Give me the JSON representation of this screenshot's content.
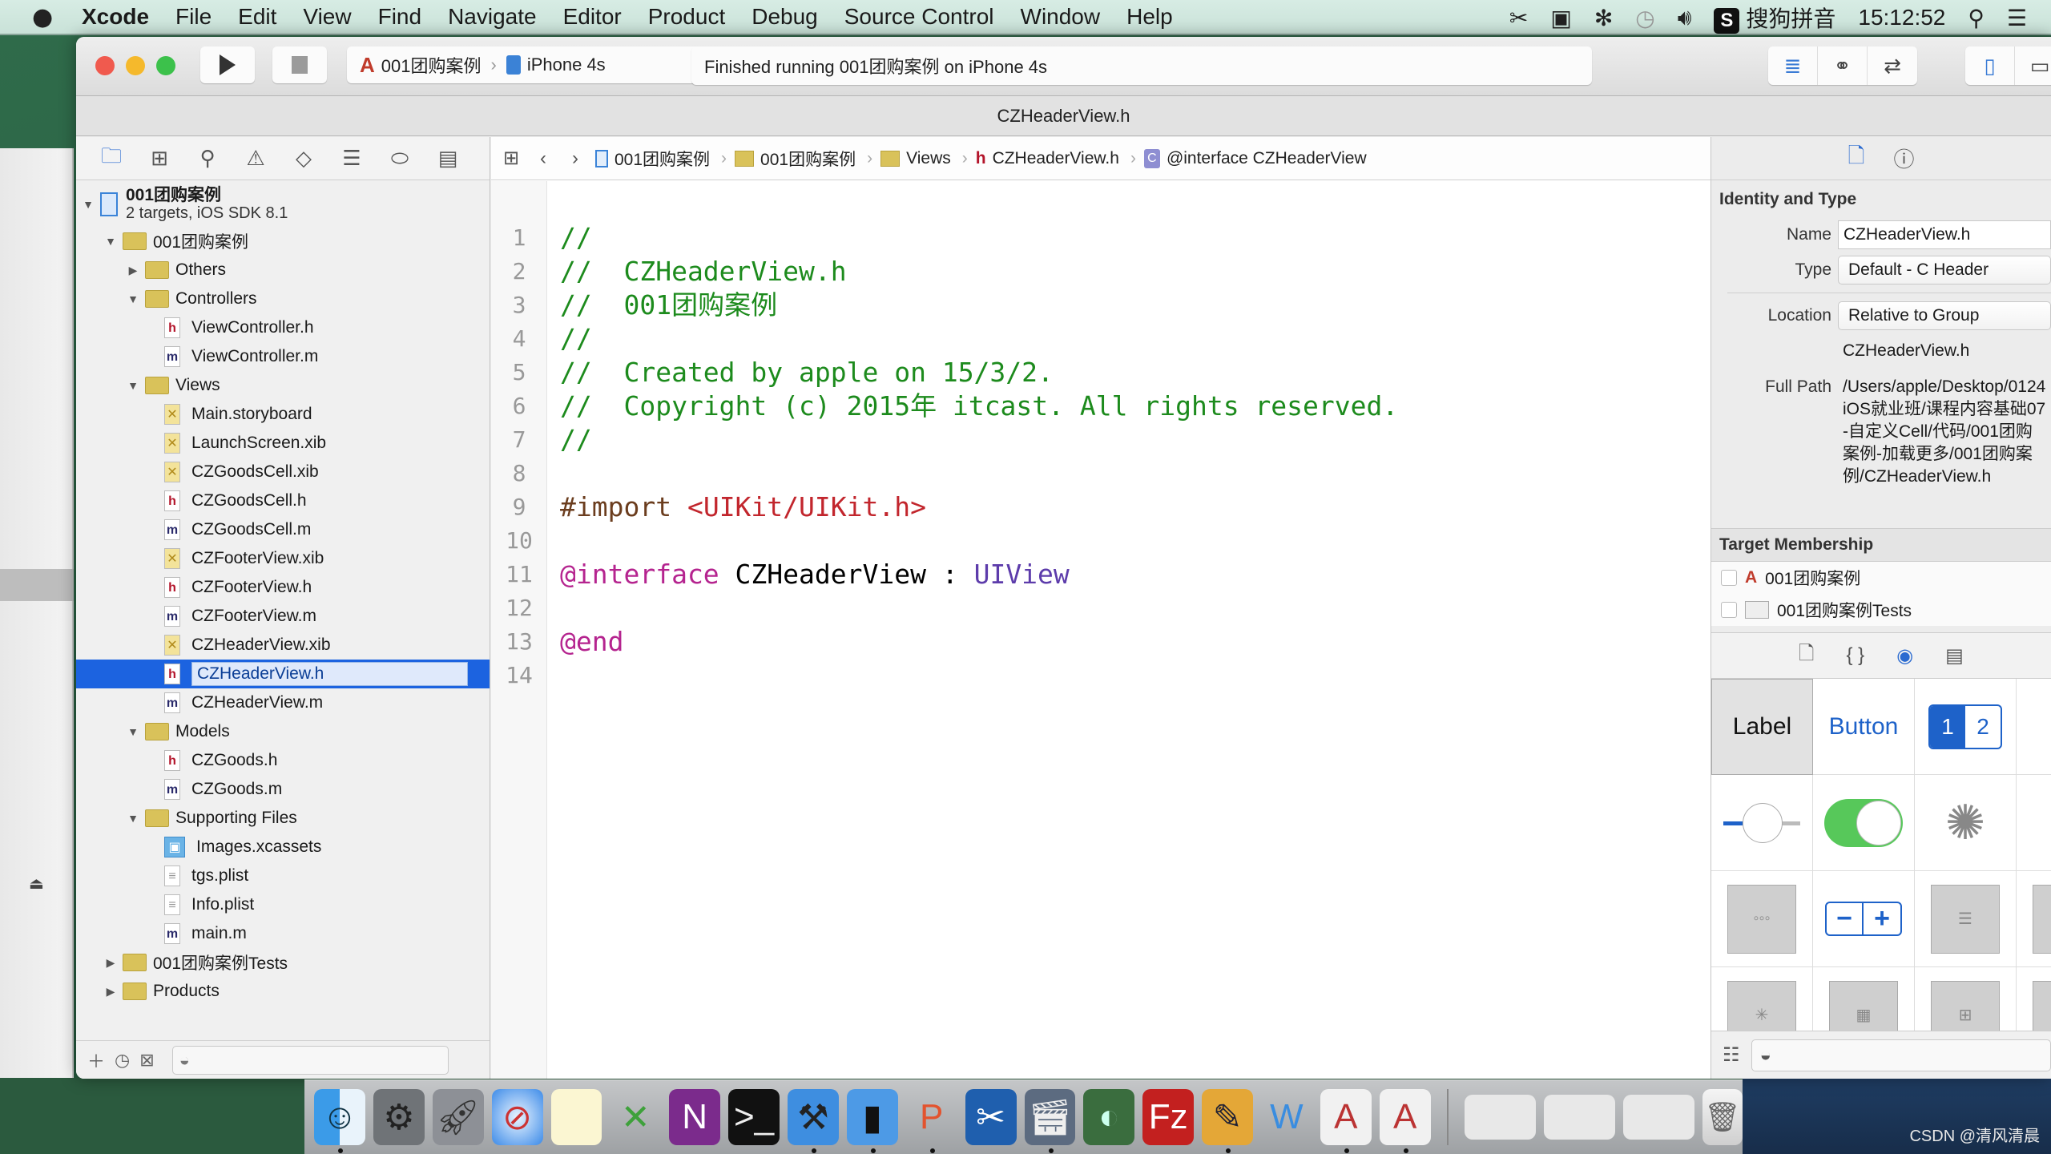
{
  "menubar": {
    "apple_icon": "apple-logo",
    "items": [
      "Xcode",
      "File",
      "Edit",
      "View",
      "Find",
      "Navigate",
      "Editor",
      "Product",
      "Debug",
      "Source Control",
      "Window",
      "Help"
    ],
    "status": {
      "ime_badge": "S",
      "ime_name": "搜狗拼音",
      "time": "15:12:52"
    }
  },
  "toolbar": {
    "scheme": "001团购案例",
    "device": "iPhone 4s",
    "activity": "Finished running 001团购案例 on iPhone 4s"
  },
  "window": {
    "title": "CZHeaderView.h"
  },
  "navigator": {
    "project": {
      "name": "001团购案例",
      "subtitle": "2 targets, iOS SDK 8.1"
    },
    "tree": [
      {
        "label": "001团购案例",
        "kind": "group",
        "level": 1,
        "expanded": true
      },
      {
        "label": "Others",
        "kind": "group",
        "level": 2,
        "expanded": false
      },
      {
        "label": "Controllers",
        "kind": "group",
        "level": 2,
        "expanded": true
      },
      {
        "label": "ViewController.h",
        "kind": "h",
        "level": 3
      },
      {
        "label": "ViewController.m",
        "kind": "m",
        "level": 3
      },
      {
        "label": "Views",
        "kind": "group",
        "level": 2,
        "expanded": true
      },
      {
        "label": "Main.storyboard",
        "kind": "xib",
        "level": 3
      },
      {
        "label": "LaunchScreen.xib",
        "kind": "xib",
        "level": 3
      },
      {
        "label": "CZGoodsCell.xib",
        "kind": "xib",
        "level": 3
      },
      {
        "label": "CZGoodsCell.h",
        "kind": "h",
        "level": 3
      },
      {
        "label": "CZGoodsCell.m",
        "kind": "m",
        "level": 3
      },
      {
        "label": "CZFooterView.xib",
        "kind": "xib",
        "level": 3
      },
      {
        "label": "CZFooterView.h",
        "kind": "h",
        "level": 3
      },
      {
        "label": "CZFooterView.m",
        "kind": "m",
        "level": 3
      },
      {
        "label": "CZHeaderView.xib",
        "kind": "xib",
        "level": 3
      },
      {
        "label": "CZHeaderView.h",
        "kind": "h",
        "level": 3,
        "selected": true
      },
      {
        "label": "CZHeaderView.m",
        "kind": "m",
        "level": 3
      },
      {
        "label": "Models",
        "kind": "group",
        "level": 2,
        "expanded": true
      },
      {
        "label": "CZGoods.h",
        "kind": "h",
        "level": 3
      },
      {
        "label": "CZGoods.m",
        "kind": "m",
        "level": 3
      },
      {
        "label": "Supporting Files",
        "kind": "group",
        "level": 2,
        "expanded": true
      },
      {
        "label": "Images.xcassets",
        "kind": "assets",
        "level": 3
      },
      {
        "label": "tgs.plist",
        "kind": "plist",
        "level": 3
      },
      {
        "label": "Info.plist",
        "kind": "plist",
        "level": 3
      },
      {
        "label": "main.m",
        "kind": "m",
        "level": 3
      },
      {
        "label": "001团购案例Tests",
        "kind": "group",
        "level": 1,
        "expanded": false
      },
      {
        "label": "Products",
        "kind": "group",
        "level": 1,
        "expanded": false
      }
    ]
  },
  "jumpbar": {
    "crumbs": [
      "001团购案例",
      "001团购案例",
      "Views",
      "CZHeaderView.h",
      "@interface CZHeaderView"
    ]
  },
  "editor": {
    "lines": [
      [
        {
          "t": "//",
          "c": "comment"
        }
      ],
      [
        {
          "t": "//  CZHeaderView.h",
          "c": "comment"
        }
      ],
      [
        {
          "t": "//  001团购案例",
          "c": "comment"
        }
      ],
      [
        {
          "t": "//",
          "c": "comment"
        }
      ],
      [
        {
          "t": "//  Created by apple on 15/3/2.",
          "c": "comment"
        }
      ],
      [
        {
          "t": "//  Copyright (c) 2015年 itcast. All rights reserved.",
          "c": "comment"
        }
      ],
      [
        {
          "t": "//",
          "c": "comment"
        }
      ],
      [],
      [
        {
          "t": "#import ",
          "c": "pre"
        },
        {
          "t": "<UIKit/UIKit.h>",
          "c": "string"
        }
      ],
      [],
      [
        {
          "t": "@interface",
          "c": "kw"
        },
        {
          "t": " CZHeaderView : ",
          "c": "plain"
        },
        {
          "t": "UIView",
          "c": "type"
        }
      ],
      [],
      [
        {
          "t": "@end",
          "c": "kw"
        }
      ],
      []
    ]
  },
  "inspector": {
    "identity_title": "Identity and Type",
    "name_label": "Name",
    "name_value": "CZHeaderView.h",
    "type_label": "Type",
    "type_value": "Default - C Header",
    "location_label": "Location",
    "location_value": "Relative to Group",
    "location_file": "CZHeaderView.h",
    "fullpath_label": "Full Path",
    "fullpath_value": "/Users/apple/Desktop/0124iOS就业班/课程内容基础07-自定义Cell/代码/001团购案例-加载更多/001团购案例/CZHeaderView.h",
    "membership_title": "Target Membership",
    "targets": [
      {
        "name": "001团购案例",
        "checked": false
      },
      {
        "name": "001团购案例Tests",
        "checked": false
      }
    ],
    "library": {
      "label_item": "Label",
      "button_item": "Button",
      "segment_items": [
        "1",
        "2"
      ],
      "switch_on": true
    }
  },
  "dock": {
    "apps": [
      "Finder",
      "System Preferences",
      "Launchpad",
      "Safari",
      "Notes",
      "Excel",
      "OneNote",
      "Terminal",
      "Xcode",
      "Simulator",
      "Keynote",
      "Screenshot",
      "Video",
      "FTP",
      "FileZilla",
      "Pages",
      "Word",
      "Xcode Doc",
      "Xcode Doc"
    ],
    "watermark": "CSDN @清风清晨"
  }
}
